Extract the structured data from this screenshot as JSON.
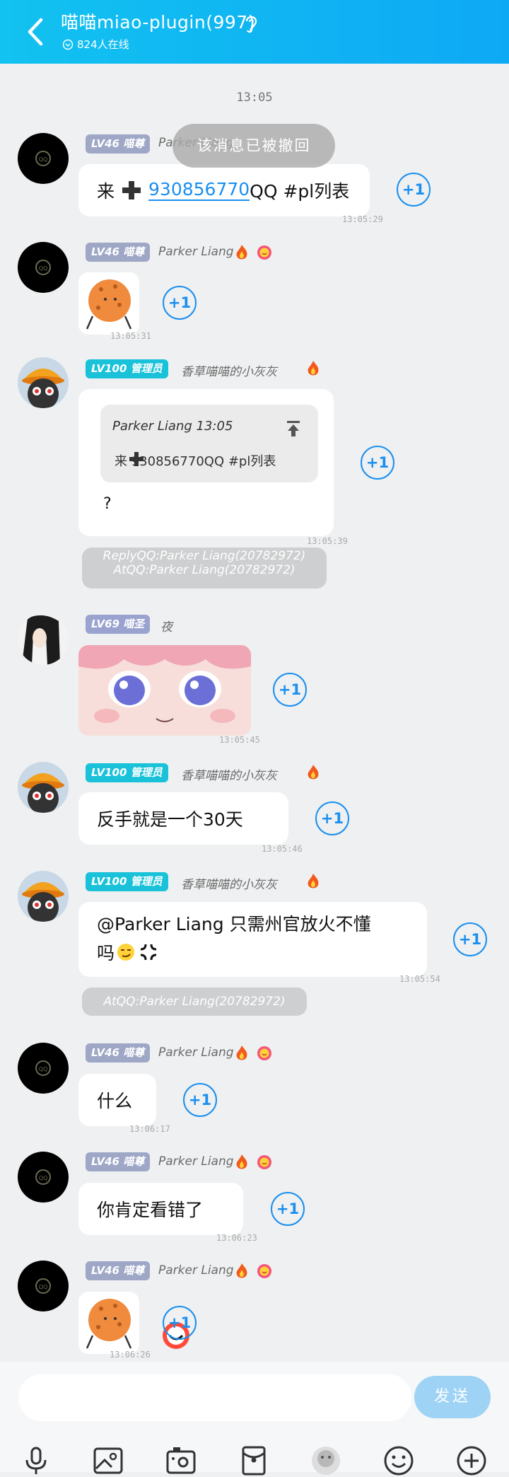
{
  "header": {
    "title": "喵喵miao-plugin(997)",
    "online": "824人在线"
  },
  "time_separator": "13:05",
  "recall_toast": "该消息已被撤回",
  "messages": [
    {
      "level": "LV46 喵尊",
      "name": "Parker Liang",
      "prefix": "来",
      "number": "930856770",
      "suffix": "QQ #pl列表",
      "time": "13:05:29",
      "plus": "+1"
    },
    {
      "level": "LV46 喵尊",
      "name": "Parker Liang",
      "time": "13:05:31",
      "plus": "+1"
    },
    {
      "level": "LV100 管理员",
      "name": "香草喵喵的小灰灰",
      "quote_author": "Parker Liang 13:05",
      "quote_text": "来  930856770QQ #pl列表",
      "text": "?",
      "time": "13:05:39",
      "plus": "+1",
      "reply_info": "ReplyQQ:Parker Liang(20782972)",
      "at_info": "AtQQ:Parker Liang(20782972)"
    },
    {
      "level": "LV69 喵圣",
      "name": "夜",
      "time": "13:05:45",
      "plus": "+1"
    },
    {
      "level": "LV100 管理员",
      "name": "香草喵喵的小灰灰",
      "text": "反手就是一个30天",
      "time": "13:05:46",
      "plus": "+1"
    },
    {
      "level": "LV100 管理员",
      "name": "香草喵喵的小灰灰",
      "line1": "@Parker Liang 只需州官放火不懂",
      "line2": "吗",
      "time": "13:05:54",
      "plus": "+1",
      "at_info": "AtQQ:Parker Liang(20782972)"
    },
    {
      "level": "LV46 喵尊",
      "name": "Parker Liang",
      "text": "什么",
      "time": "13:06:17",
      "plus": "+1"
    },
    {
      "level": "LV46 喵尊",
      "name": "Parker Liang",
      "text": "你肯定看错了",
      "time": "13:06:23",
      "plus": "+1"
    },
    {
      "level": "LV46 喵尊",
      "name": "Parker Liang",
      "time": "13:06:26",
      "plus": "+1"
    }
  ],
  "composer": {
    "placeholder": "",
    "send": "发送"
  },
  "toolbar_icons": [
    "microphone-icon",
    "image-icon",
    "camera-icon",
    "red-packet-icon",
    "avatar-icon",
    "emoji-icon",
    "plus-icon"
  ],
  "colors": {
    "header": "#0ea9f5",
    "plus_one": "#1a8ff0",
    "admin_badge": "#19c2d8",
    "link": "#1a8ff0"
  }
}
